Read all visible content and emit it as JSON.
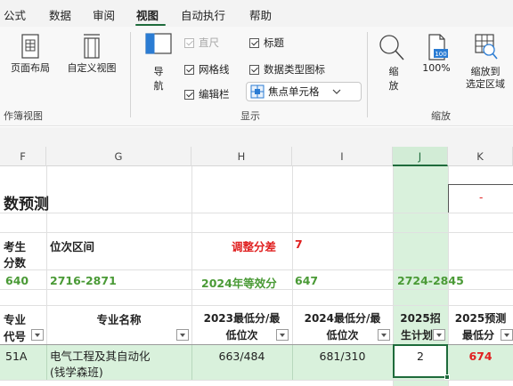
{
  "menu": {
    "tabs": [
      "公式",
      "数据",
      "审阅",
      "视图",
      "自动执行",
      "帮助"
    ],
    "active": "视图"
  },
  "ribbon": {
    "workbook_views": {
      "page_layout": "页面布局",
      "custom_view": "自定义视图",
      "group_label": "作簿视图"
    },
    "show": {
      "navigate_line1": "导",
      "navigate_line2": "航",
      "ruler": "直尺",
      "gridlines": "网格线",
      "formula_bar": "编辑栏",
      "headings": "标题",
      "data_type_icons": "数据类型图标",
      "focus_cell": "焦点单元格",
      "group_label": "显示"
    },
    "zoom": {
      "zoom_line1": "缩",
      "zoom_line2": "放",
      "hundred": "100%",
      "zoom_to_sel_line1": "缩放到",
      "zoom_to_sel_line2": "选定区域",
      "group_label": "缩放"
    }
  },
  "sheet": {
    "columns": [
      "F",
      "G",
      "H",
      "I",
      "J",
      "K"
    ],
    "selected_column": "J",
    "rows": {
      "title": "数预测",
      "k_dash": "-",
      "exam_label_1": "考生",
      "exam_label_2": "分数",
      "range_label": "位次区间",
      "adjust_label": "调整分差",
      "adjust_value": "7",
      "score": "640",
      "rank_range": "2716-2871",
      "equiv_label": "2024年等效分",
      "equiv_value": "647",
      "j_range": "2724-2845",
      "hdr_major_code_1": "专业",
      "hdr_major_code_2": "代号",
      "hdr_major_name": "专业名称",
      "hdr_2023_1": "2023最低分/最",
      "hdr_2023_2": "低位次",
      "hdr_2024_1": "2024最低分/最",
      "hdr_2024_2": "低位次",
      "hdr_2025plan_1": "2025招",
      "hdr_2025plan_2": "生计划",
      "hdr_2025pred_1": "2025预测",
      "hdr_2025pred_2": "最低分",
      "data_code": "51A",
      "data_name_1": "电气工程及其自动化",
      "data_name_2": "(钱学森班)",
      "data_2023": "663/484",
      "data_2024": "681/310",
      "data_plan": "2",
      "data_pred": "674"
    }
  },
  "colors": {
    "accent_green": "#1e6b3b",
    "red": "#e02020",
    "value_green": "#4a9a36",
    "selected_column_fill": "#d9f1dc"
  }
}
